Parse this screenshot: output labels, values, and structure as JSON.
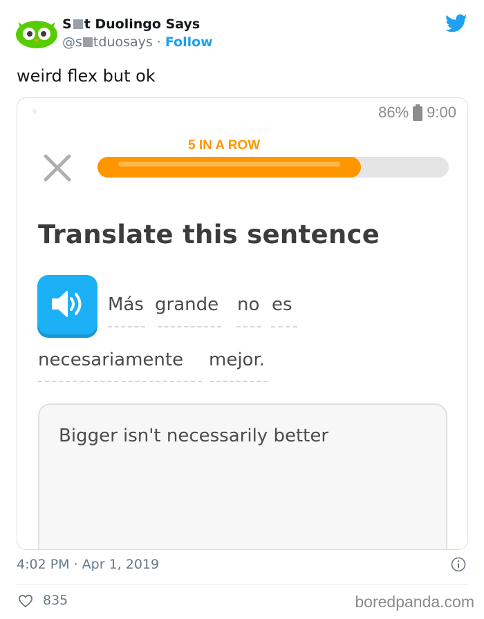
{
  "tweet": {
    "author_name_start": "S",
    "author_name_end": "t Duolingo Says",
    "handle_start": "@s",
    "handle_end": "tduosays",
    "separator": "·",
    "follow_label": "Follow",
    "text": "weird flex but ok",
    "timestamp": "4:02 PM · Apr 1, 2019",
    "likes": "835",
    "watermark": "boredpanda.com"
  },
  "screenshot": {
    "battery": "86%",
    "time": "9:00",
    "streak_label": "5 IN A ROW",
    "progress_fraction": 0.75,
    "title": "Translate this sentence",
    "sentence_words": [
      "Más",
      "grande",
      "no",
      "es",
      "necesariamente",
      "mejor."
    ],
    "answer": "Bigger isn't necessarily better"
  },
  "colors": {
    "twitter_blue": "#1da1f2",
    "duolingo_orange": "#ff9600",
    "duolingo_blue": "#1cb0f6",
    "owl_green": "#58cc02"
  },
  "icons": {
    "avatar": "duolingo-owl-icon",
    "brand": "twitter-bird-icon",
    "close": "close-icon",
    "speaker": "speaker-icon",
    "info": "info-icon",
    "like": "heart-icon",
    "battery": "battery-icon"
  }
}
